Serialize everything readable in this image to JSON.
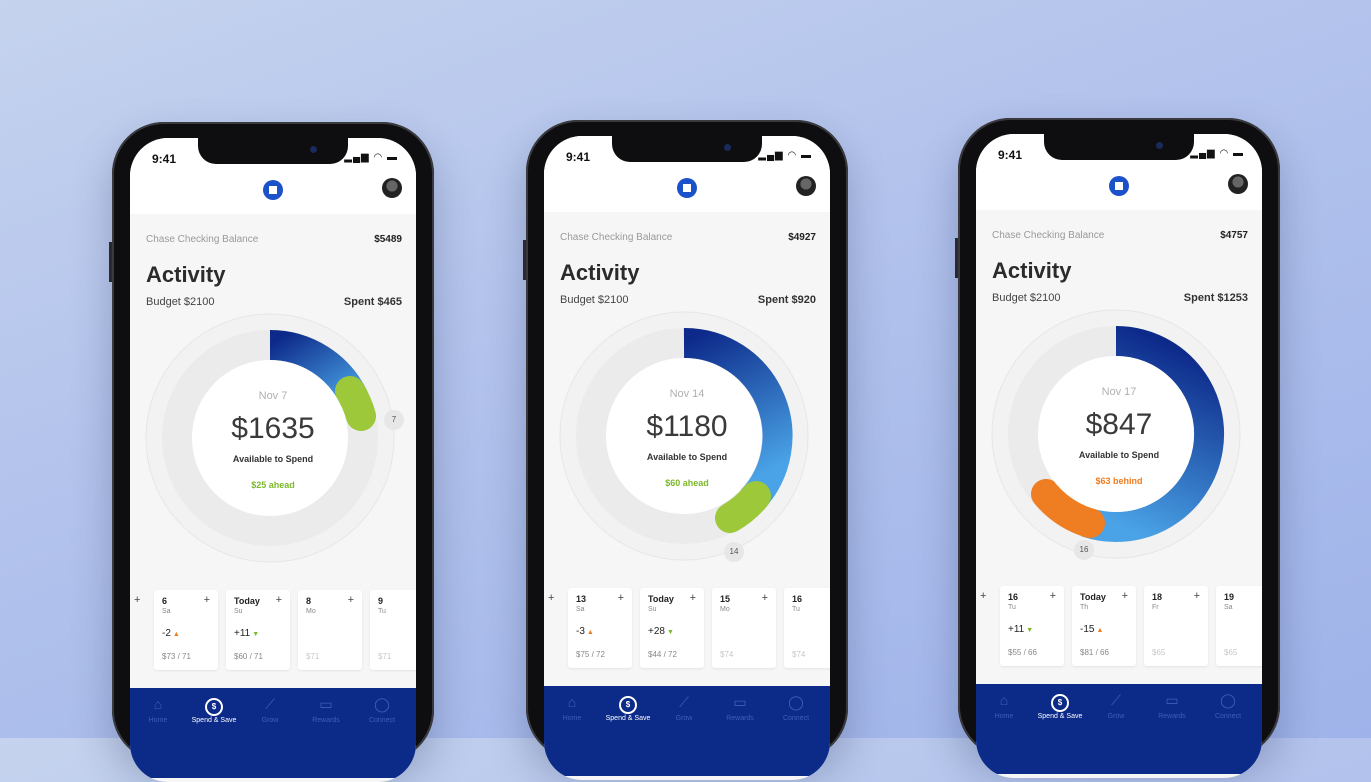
{
  "phones": [
    {
      "time": "9:41",
      "balance_label": "Chase Checking Balance",
      "balance_value": "$5489",
      "title": "Activity",
      "budget": "Budget $2100",
      "spent": "Spent $465",
      "ring": {
        "date": "Nov 7",
        "amount": "$1635",
        "label": "Available to Spend",
        "status": "$25 ahead",
        "status_color": "#7cb82a",
        "marker": "7"
      },
      "days": [
        {
          "num": "6",
          "dow": "Sa",
          "delta": "-2",
          "dir": "up",
          "ratio": "$73 / 71"
        },
        {
          "num": "Today",
          "dow": "Su",
          "delta": "+11",
          "dir": "down",
          "ratio": "$60 / 71"
        },
        {
          "num": "8",
          "dow": "Mo",
          "delta": "",
          "dir": "",
          "ratio": "$71"
        },
        {
          "num": "9",
          "dow": "Tu",
          "delta": "",
          "dir": "",
          "ratio": "$71"
        }
      ]
    },
    {
      "time": "9:41",
      "balance_label": "Chase Checking Balance",
      "balance_value": "$4927",
      "title": "Activity",
      "budget": "Budget $2100",
      "spent": "Spent $920",
      "ring": {
        "date": "Nov 14",
        "amount": "$1180",
        "label": "Available to Spend",
        "status": "$60 ahead",
        "status_color": "#7cb82a",
        "marker": "14"
      },
      "days": [
        {
          "num": "13",
          "dow": "Sa",
          "delta": "-3",
          "dir": "up",
          "ratio": "$75 / 72"
        },
        {
          "num": "Today",
          "dow": "Su",
          "delta": "+28",
          "dir": "down",
          "ratio": "$44 / 72"
        },
        {
          "num": "15",
          "dow": "Mo",
          "delta": "",
          "dir": "",
          "ratio": "$74"
        },
        {
          "num": "16",
          "dow": "Tu",
          "delta": "",
          "dir": "",
          "ratio": "$74"
        }
      ]
    },
    {
      "time": "9:41",
      "balance_label": "Chase Checking Balance",
      "balance_value": "$4757",
      "title": "Activity",
      "budget": "Budget $2100",
      "spent": "Spent $1253",
      "ring": {
        "date": "Nov 17",
        "amount": "$847",
        "label": "Available to Spend",
        "status": "$63 behind",
        "status_color": "#ef7d22",
        "marker": "16"
      },
      "days": [
        {
          "num": "16",
          "dow": "Tu",
          "delta": "+11",
          "dir": "down",
          "ratio": "$55 / 66"
        },
        {
          "num": "Today",
          "dow": "Th",
          "delta": "-15",
          "dir": "up",
          "ratio": "$81 / 66"
        },
        {
          "num": "18",
          "dow": "Fr",
          "delta": "",
          "dir": "",
          "ratio": "$65"
        },
        {
          "num": "19",
          "dow": "Sa",
          "delta": "",
          "dir": "",
          "ratio": "$65"
        }
      ]
    }
  ],
  "tabs": [
    {
      "label": "Home",
      "icon": "home-icon"
    },
    {
      "label": "Spend & Save",
      "icon": "coin-icon"
    },
    {
      "label": "Grow",
      "icon": "trend-icon"
    },
    {
      "label": "Rewards",
      "icon": "card-icon"
    },
    {
      "label": "Connect",
      "icon": "chat-icon"
    }
  ],
  "active_tab_index": 1,
  "colors": {
    "brand_blue": "#0c2a88",
    "ring_gradient_start": "#0d2a8a",
    "ring_gradient_end": "#4aa3e6",
    "ahead_green": "#9cc83a",
    "behind_orange": "#ef7d22"
  }
}
